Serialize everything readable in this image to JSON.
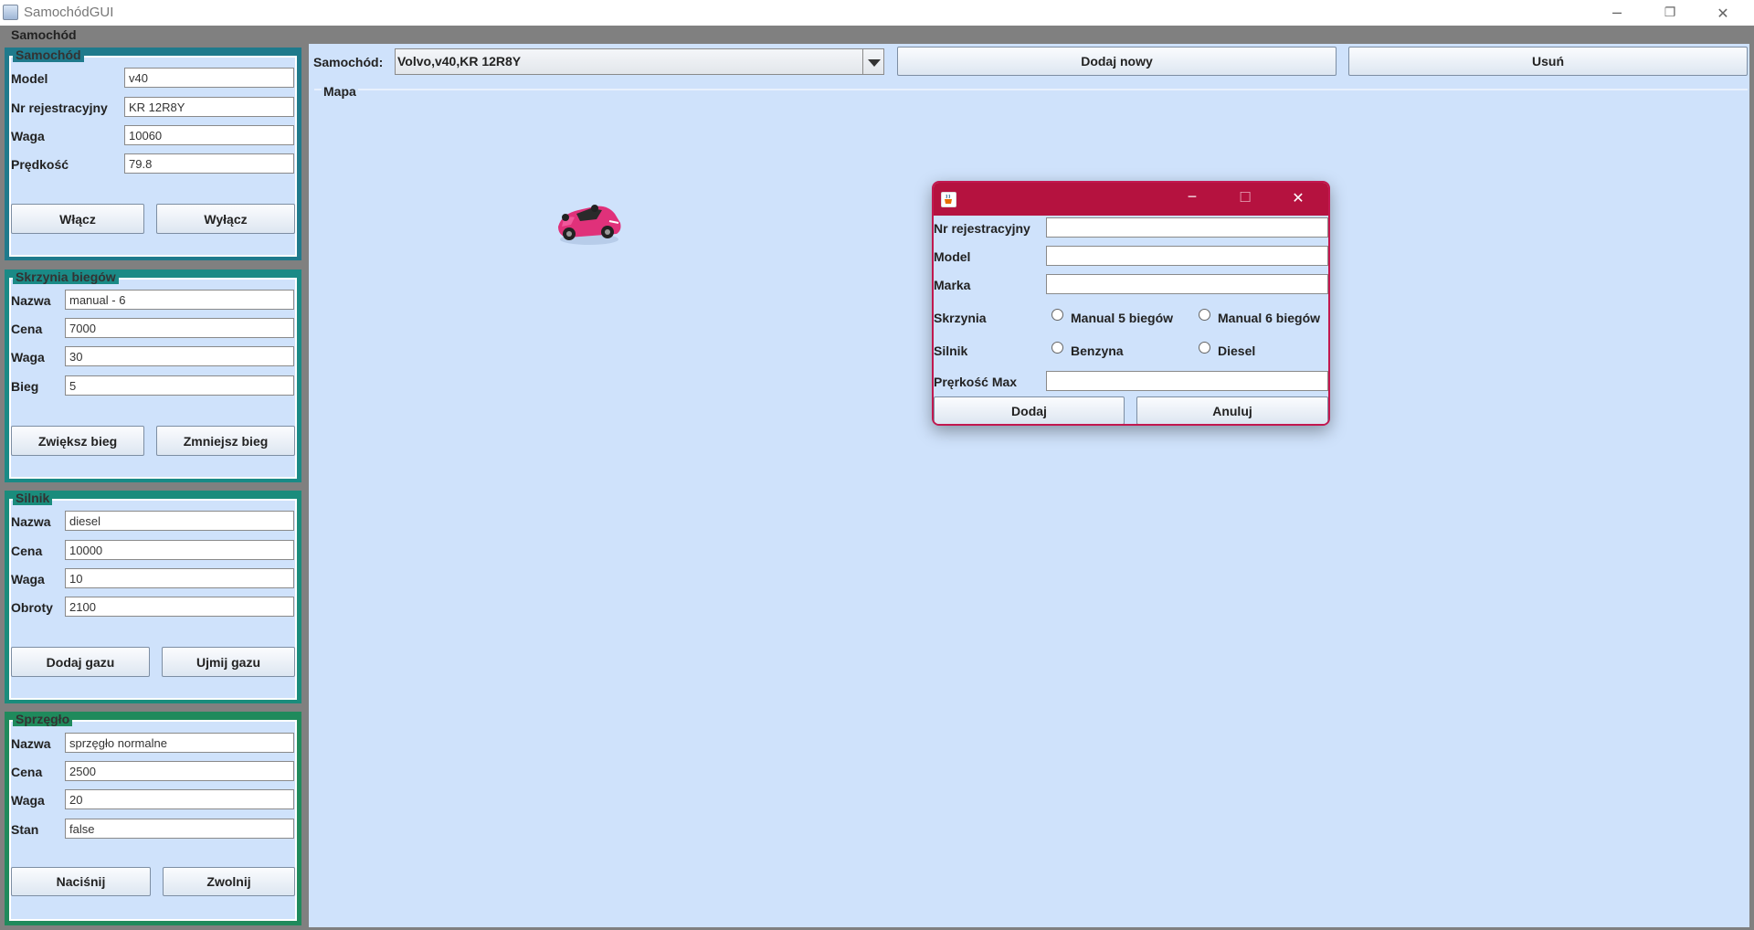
{
  "window": {
    "title": "SamochódGUI",
    "controls": {
      "minimize": "─",
      "maximize": "❐",
      "close": "✕"
    }
  },
  "outer_frame": {
    "label": "Samochód"
  },
  "samochod_panel": {
    "legend": "Samochód",
    "fields": [
      {
        "label": "Model",
        "value": "v40"
      },
      {
        "label": "Nr rejestracyjny",
        "value": "KR 12R8Y"
      },
      {
        "label": "Waga",
        "value": "10060"
      },
      {
        "label": "Prędkość",
        "value": "79.8"
      }
    ],
    "buttons": [
      "Włącz",
      "Wyłącz"
    ]
  },
  "skrzynia_panel": {
    "legend": "Skrzynia biegów",
    "fields": [
      {
        "label": "Nazwa",
        "value": "manual - 6"
      },
      {
        "label": "Cena",
        "value": "7000"
      },
      {
        "label": "Waga",
        "value": "30"
      },
      {
        "label": "Bieg",
        "value": "5"
      }
    ],
    "buttons": [
      "Zwiększ bieg",
      "Zmniejsz bieg"
    ]
  },
  "silnik_panel": {
    "legend": "Silnik",
    "fields": [
      {
        "label": "Nazwa",
        "value": "diesel"
      },
      {
        "label": "Cena",
        "value": "10000"
      },
      {
        "label": "Waga",
        "value": "10"
      },
      {
        "label": "Obroty",
        "value": "2100"
      }
    ],
    "buttons": [
      "Dodaj gazu",
      "Ujmij gazu"
    ]
  },
  "sprzeglo_panel": {
    "legend": "Sprzęgło",
    "fields": [
      {
        "label": "Nazwa",
        "value": "sprzęgło normalne"
      },
      {
        "label": "Cena",
        "value": "2500"
      },
      {
        "label": "Waga",
        "value": "20"
      },
      {
        "label": "Stan",
        "value": "false"
      }
    ],
    "buttons": [
      "Naciśnij",
      "Zwolnij"
    ]
  },
  "toolbar": {
    "car_label": "Samochód:",
    "car_selected": "Volvo,v40,KR 12R8Y",
    "add_new": "Dodaj nowy",
    "remove": "Usuń"
  },
  "map": {
    "label": "Mapa",
    "car_icon": "car-icon"
  },
  "dialog": {
    "controls": {
      "minimize": "─",
      "maximize": "☐",
      "close": "✕"
    },
    "fields": {
      "nr_label": "Nr rejestracyjny",
      "nr_value": "",
      "model_label": "Model",
      "model_value": "",
      "marka_label": "Marka",
      "marka_value": "",
      "max_label": "Pręrkość Max",
      "max_value": ""
    },
    "skrzynia_label": "Skrzynia",
    "skrzynia_options": [
      "Manual 5 biegów",
      "Manual 6 biegów"
    ],
    "silnik_label": "Silnik",
    "silnik_options": [
      "Benzyna",
      "Diesel"
    ],
    "buttons": {
      "add": "Dodaj",
      "cancel": "Anuluj"
    }
  },
  "colors": {
    "frame": "#808080",
    "panel_bg": "#cfe2fb",
    "samochod_border": "#1f7a8c",
    "skrzynia_border": "#1a8a86",
    "silnik_border": "#1a8c7c",
    "sprzeglo_border": "#1f8a5c",
    "dialog_title": "#b5123f"
  }
}
